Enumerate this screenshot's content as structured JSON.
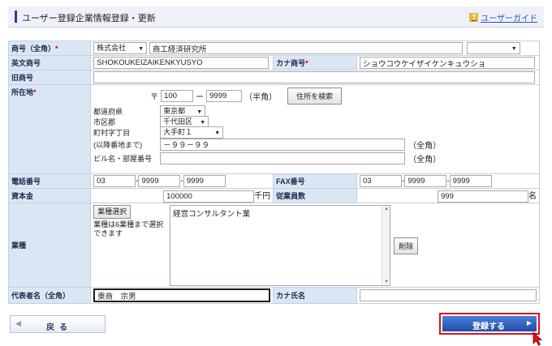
{
  "header": {
    "title": "ユーザー登録企業情報登録・更新",
    "guide_label": "ユーザーガイド",
    "guide_icon": "?"
  },
  "form": {
    "company_name": {
      "label": "商号（全角）",
      "required_mark": "*",
      "type_select": "株式会社",
      "value": "商工経済研究所",
      "position_select": ""
    },
    "english_name": {
      "label": "英文商号",
      "value": "SHOKOUKEIZAIKENKYUSYO"
    },
    "kana_name": {
      "label": "カナ商号",
      "required_mark": "*",
      "value": "ショウコウケイザイケンキュウショ"
    },
    "old_name": {
      "label": "旧商号",
      "value": ""
    },
    "address": {
      "label": "所在地",
      "required_mark": "*",
      "postal_mark": "〒",
      "postal1": "100",
      "postal_dash": "ー",
      "postal2": "9999",
      "postal_note": "（半角）",
      "search_button": "住所を検索",
      "prefecture_label": "都道府県",
      "prefecture": "東京都",
      "city_label": "市区郡",
      "city": "千代田区",
      "town_label": "町村字丁目",
      "town": "大手町１",
      "street_label": "(以降番地まで)",
      "street": "－９９－９９",
      "street_note": "（全角）",
      "building_label": "ビル名・部屋番号",
      "building": "",
      "building_note": "（全角）"
    },
    "phone": {
      "label": "電話番号",
      "p1": "03",
      "p2": "9999",
      "p3": "9999"
    },
    "fax": {
      "label": "FAX番号",
      "p1": "03",
      "p2": "9999",
      "p3": "9999"
    },
    "capital": {
      "label": "資本金",
      "value": "100000",
      "unit": "千円"
    },
    "employees": {
      "label": "従業員数",
      "value": "999",
      "unit": "名"
    },
    "industry": {
      "label": "業種",
      "select_button": "業種選択",
      "note": "業種は6業種まで選択できます",
      "value": "経営コンサルタント業",
      "delete_button": "削除"
    },
    "representative": {
      "label": "代表者名（全角）",
      "value": "東商　宗男"
    },
    "rep_kana": {
      "label": "カナ氏名",
      "value": ""
    }
  },
  "footer": {
    "back_button": "戻る",
    "register_button": "登録する"
  },
  "colors": {
    "label_bg": "#dbe6f5",
    "required": "#d40000",
    "register_bg": "#1f4ca8",
    "highlight_border": "#e0101a"
  }
}
